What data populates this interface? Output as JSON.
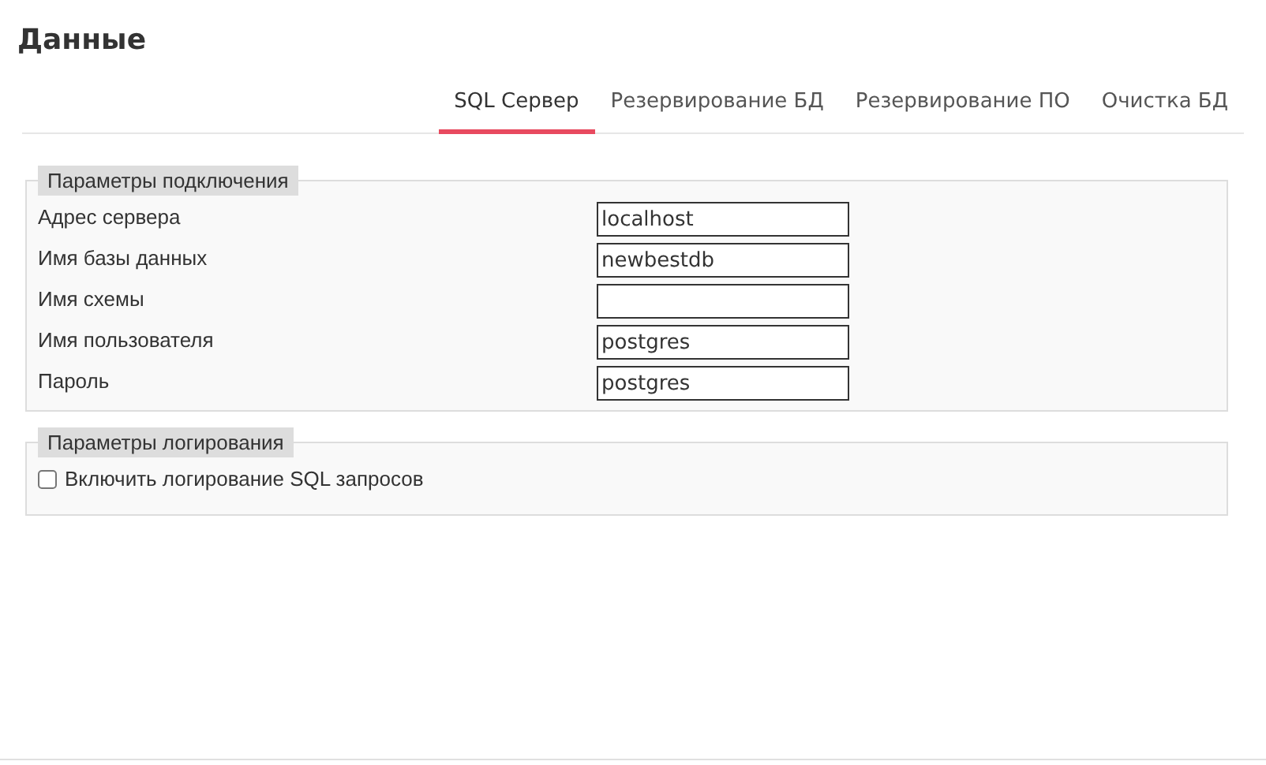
{
  "page": {
    "title": "Данные"
  },
  "tabs": [
    {
      "label": "SQL Сервер",
      "selected": true
    },
    {
      "label": "Резервирование БД",
      "selected": false
    },
    {
      "label": "Резервирование ПО",
      "selected": false
    },
    {
      "label": "Очистка БД",
      "selected": false
    }
  ],
  "connection": {
    "legend": "Параметры подключения",
    "fields": [
      {
        "label": "Адрес сервера",
        "value": "localhost"
      },
      {
        "label": "Имя базы данных",
        "value": "newbestdb"
      },
      {
        "label": "Имя схемы"
      },
      {
        "label": "Имя пользователя",
        "value": "postgres"
      },
      {
        "label": "Пароль",
        "value": "postgres"
      }
    ]
  },
  "logging": {
    "legend": "Параметры логирования",
    "options": [
      {
        "label": "Включить логирование SQL запросов",
        "checked": false
      }
    ]
  }
}
